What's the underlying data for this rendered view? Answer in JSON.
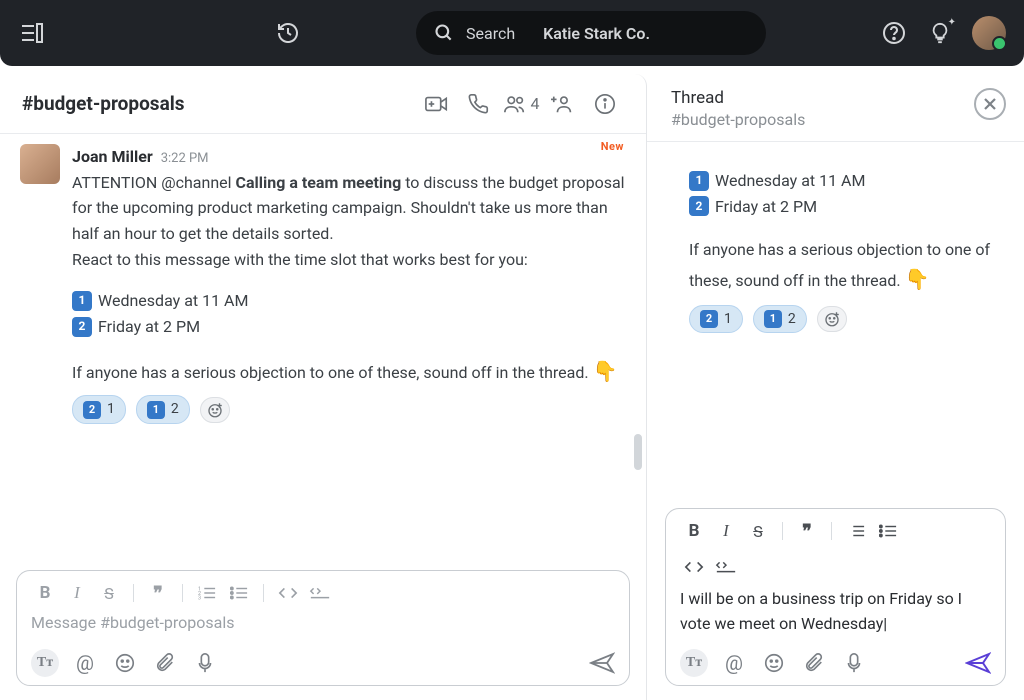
{
  "topbar": {
    "search_label": "Search",
    "workspace": "Katie Stark Co."
  },
  "channel": {
    "name": "#budget-proposals",
    "member_count": "4",
    "new_label": "New"
  },
  "message": {
    "author": "Joan Miller",
    "time": "3:22 PM",
    "line1_a": "ATTENTION @channel ",
    "line1_bold": "Calling a team meeting",
    "line1_b": " to discuss the budget proposal for the upcoming product marketing campaign. Shouldn't take us more than half an hour to get the details sorted.",
    "react_prompt": "React to this message with the time slot that works best for you:",
    "slot1_num": "1",
    "slot1_text": "Wednesday at 11 AM",
    "slot2_num": "2",
    "slot2_text": "Friday at 2 PM",
    "objection": "If anyone has a serious objection to one of these, sound off in the thread.  ",
    "point": "👇",
    "react1_emoji": "2",
    "react1_count": "1",
    "react2_emoji": "1",
    "react2_count": "2"
  },
  "composer": {
    "placeholder": "Message #budget-proposals"
  },
  "thread": {
    "title": "Thread",
    "channel": "#budget-proposals",
    "slot1_num": "1",
    "slot1_text": "Wednesday at 11 AM",
    "slot2_num": "2",
    "slot2_text": "Friday at 2 PM",
    "objection": "If anyone has a serious objection to one of these, sound off in the thread.  ",
    "point": "👇",
    "react1_emoji": "2",
    "react1_count": "1",
    "react2_emoji": "1",
    "react2_count": "2",
    "reply_text": "I will be on a business trip on Friday so I vote we meet on Wednesday"
  }
}
